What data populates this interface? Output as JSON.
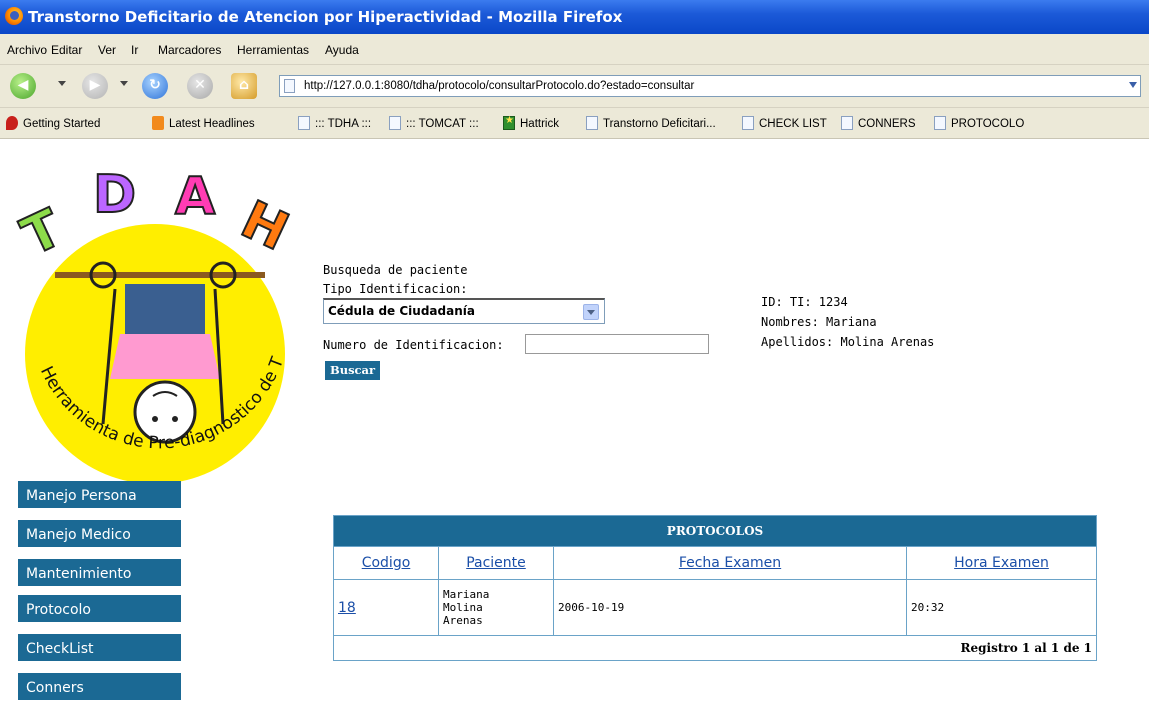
{
  "window": {
    "title": "Transtorno Deficitario de Atencion por Hiperactividad - Mozilla Firefox"
  },
  "menu": [
    "Archivo",
    "Editar",
    "Ver",
    "Ir",
    "Marcadores",
    "Herramientas",
    "Ayuda"
  ],
  "url": "http://127.0.0.1:8080/tdha/protocolo/consultarProtocolo.do?estado=consultar",
  "bookmarks": [
    {
      "label": "Getting Started",
      "icon": "red-bookmark-icon"
    },
    {
      "label": "Latest Headlines",
      "icon": "rss-icon"
    },
    {
      "label": "::: TDHA :::",
      "icon": "page-icon"
    },
    {
      "label": "::: TOMCAT :::",
      "icon": "page-icon"
    },
    {
      "label": "Hattrick",
      "icon": "hattrick-icon"
    },
    {
      "label": "Transtorno Deficitari...",
      "icon": "page-icon"
    },
    {
      "label": "CHECK LIST",
      "icon": "page-icon"
    },
    {
      "label": "CONNERS",
      "icon": "page-icon"
    },
    {
      "label": "PROTOCOLO",
      "icon": "page-icon"
    }
  ],
  "logo": {
    "letters": [
      "T",
      "D",
      "A",
      "H"
    ],
    "caption": "Herramienta de Pre-diagnostico de TDAH"
  },
  "search": {
    "heading": "Busqueda de paciente",
    "tipo_label": "Tipo Identificacion:",
    "tipo_value": "Cédula de Ciudadanía",
    "numero_label": "Numero de Identificacion:",
    "numero_value": "",
    "button": "Buscar"
  },
  "patient": {
    "id": "ID: TI: 1234",
    "nombres": "Nombres: Mariana",
    "apellidos": "Apellidos: Molina Arenas"
  },
  "sidebar": [
    "Manejo Persona",
    "Manejo Medico",
    "Mantenimiento",
    "Protocolo",
    "CheckList",
    "Conners"
  ],
  "table": {
    "title": "PROTOCOLOS",
    "columns": [
      "Codigo",
      "Paciente",
      "Fecha Examen",
      "Hora Examen"
    ],
    "rows": [
      {
        "codigo": "18",
        "paciente": [
          "Mariana",
          "Molina",
          "Arenas"
        ],
        "fecha": "2006-10-19",
        "hora": "20:32"
      }
    ],
    "footer": "Registro 1 al 1 de 1"
  },
  "colors": {
    "accent": "#1b6994",
    "logo_circle": "#ffee00"
  }
}
